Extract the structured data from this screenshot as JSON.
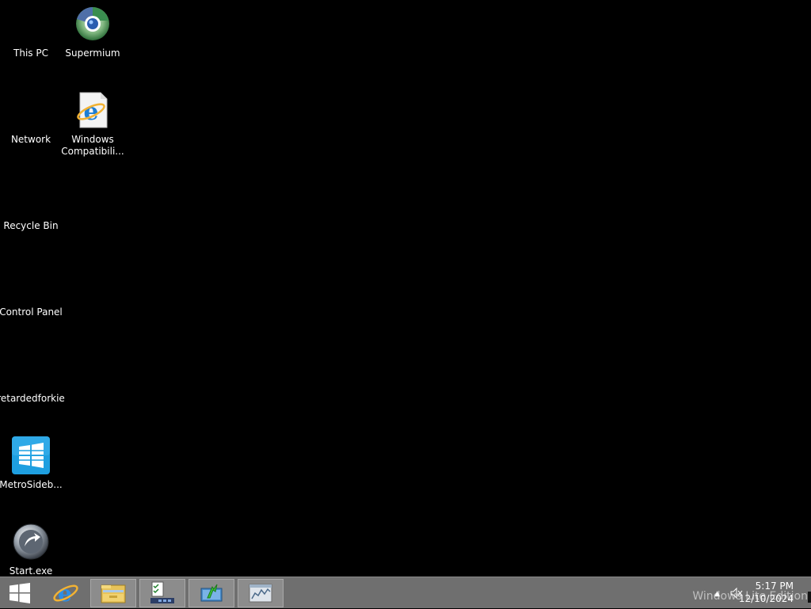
{
  "desktop": {
    "icons": [
      {
        "label": "This PC",
        "icon": "this-pc-icon"
      },
      {
        "label": "Supermium",
        "icon": "supermium-browser-icon"
      },
      {
        "label": "Network",
        "icon": "network-icon"
      },
      {
        "label": "Windows Compatibili...",
        "icon": "internet-explorer-shortcut-icon"
      },
      {
        "label": "Recycle Bin",
        "icon": "recycle-bin-icon"
      },
      {
        "label": "Control Panel",
        "icon": "control-panel-icon"
      },
      {
        "label": "retardedforkie",
        "icon": "folder-icon"
      },
      {
        "label": "MetroSideb...",
        "icon": "metro-sidebar-icon"
      },
      {
        "label": "Start.exe",
        "icon": "start-exe-icon"
      }
    ]
  },
  "taskbar": {
    "buttons": [
      {
        "name": "start-button",
        "icon": "windows-logo-icon"
      },
      {
        "name": "internet-explorer-button",
        "icon": "internet-explorer-icon"
      },
      {
        "name": "file-explorer-button",
        "icon": "file-explorer-icon"
      },
      {
        "name": "task-manager-button",
        "icon": "task-list-icon"
      },
      {
        "name": "install-app-button",
        "icon": "green-arrow-box-icon"
      },
      {
        "name": "performance-monitor-button",
        "icon": "chart-window-icon"
      }
    ],
    "tray": {
      "time": "5:17 PM",
      "date": "12/10/2024",
      "watermark": "Windows Lite Edition",
      "chevron": "▲",
      "volume_icon": "muted-speaker-icon"
    }
  },
  "colors": {
    "desktop_bg": "#000000",
    "taskbar_bg": "#6f6f6f",
    "metro_blue": "#1e9fe0",
    "ie_blue": "#1d7ed4"
  }
}
